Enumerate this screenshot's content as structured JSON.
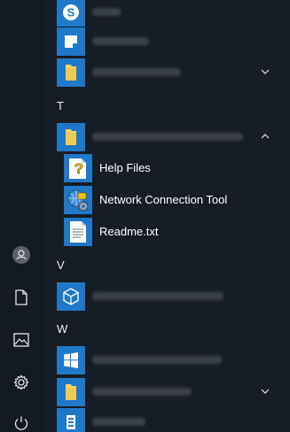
{
  "start_menu": {
    "sections": [
      {
        "letter": "T"
      },
      {
        "letter": "V"
      },
      {
        "letter": "W"
      }
    ],
    "expanded_group_items": [
      {
        "label": "Help Files",
        "icon": "help-file-icon"
      },
      {
        "label": "Network Connection Tool",
        "icon": "network-tool-icon"
      },
      {
        "label": "Readme.txt",
        "icon": "text-document-icon"
      }
    ],
    "rail_icons": [
      "user-avatar-icon",
      "document-icon",
      "pictures-icon",
      "settings-gear-icon",
      "power-icon"
    ]
  },
  "colors": {
    "background": "#171d26",
    "tile_blue": "#1f78c8",
    "folder_yellow": "#f6d26a"
  }
}
